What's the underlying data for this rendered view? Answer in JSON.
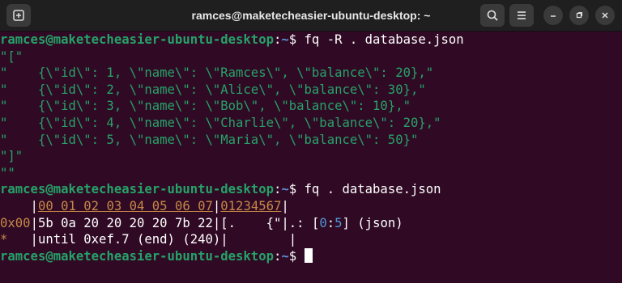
{
  "window": {
    "title": "ramces@maketecheasier-ubuntu-desktop: ~",
    "icons": {
      "new_tab": "new-tab-icon",
      "search": "search-icon",
      "menu": "menu-icon",
      "minimize": "minimize-icon",
      "maximize": "maximize-icon",
      "close": "close-icon"
    }
  },
  "colors": {
    "background": "#300a24",
    "prompt_user": "#26a269",
    "prompt_path": "#5d8fd6",
    "string": "#26a269",
    "offset": "#c68846",
    "cursor": "#ffffff"
  },
  "terminal": {
    "prompt_user": "ramces@maketecheasier-ubuntu-desktop",
    "prompt_sep": ":",
    "prompt_path": "~",
    "prompt_dollar": "$ ",
    "cmd1": "fq -R . database.json",
    "raw_lines": [
      "\"[\"",
      "\"    {\\\"id\\\": 1, \\\"name\\\": \\\"Ramces\\\", \\\"balance\\\": 20},\"",
      "\"    {\\\"id\\\": 2, \\\"name\\\": \\\"Alice\\\", \\\"balance\\\": 30},\"",
      "\"    {\\\"id\\\": 3, \\\"name\\\": \\\"Bob\\\", \\\"balance\\\": 10},\"",
      "\"    {\\\"id\\\": 4, \\\"name\\\": \\\"Charlie\\\", \\\"balance\\\": 20},\"",
      "\"    {\\\"id\\\": 5, \\\"name\\\": \\\"Maria\\\", \\\"balance\\\": 50}\"",
      "\"]\"",
      "\"\""
    ],
    "cmd2": "fq . database.json",
    "hex_header_pad": "    |",
    "hex_header_cols": "00 01 02 03 04 05 06 07",
    "hex_header_mid": "|",
    "hex_header_ascii": "01234567",
    "hex_header_end": "|",
    "hex_row_offset": "0x00",
    "hex_row_bytes": "|5b 0a 20 20 20 20 7b 22|",
    "hex_row_ascii": "[.    {\"",
    "hex_row_field_a": "|.: [",
    "hex_row_range_start": "0",
    "hex_row_range_sep": ":",
    "hex_row_range_end": "5",
    "hex_row_field_b": "] (json)",
    "hex_end_star": "*",
    "hex_end_text": "   |until 0xef.7 (end) (240)|        |"
  }
}
